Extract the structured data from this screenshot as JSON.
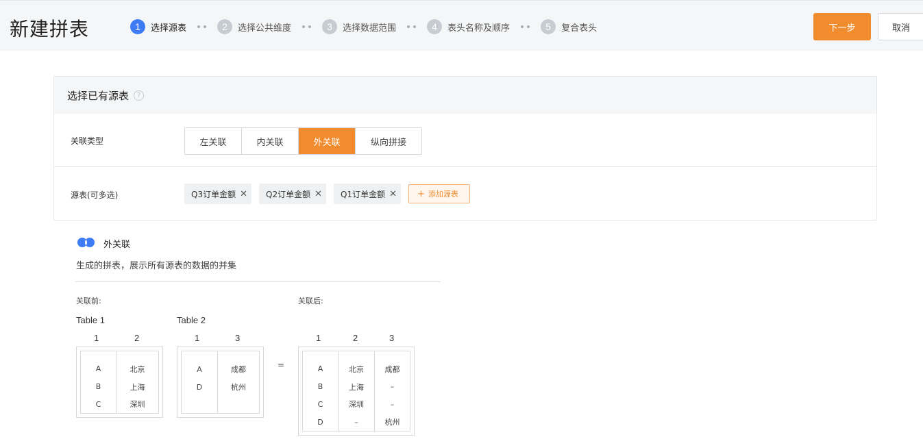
{
  "header": {
    "title": "新建拼表",
    "steps": [
      {
        "num": "1",
        "label": "选择源表"
      },
      {
        "num": "2",
        "label": "选择公共维度"
      },
      {
        "num": "3",
        "label": "选择数据范围"
      },
      {
        "num": "4",
        "label": "表头名称及顺序"
      },
      {
        "num": "5",
        "label": "复合表头"
      }
    ],
    "next_label": "下一步",
    "cancel_label": "取消"
  },
  "card": {
    "title": "选择已有源表",
    "help_glyph": "?",
    "join_type_label": "关联类型",
    "join_types": [
      "左关联",
      "内关联",
      "外关联",
      "纵向拼接"
    ],
    "source_label": "源表(可多选)",
    "sources": [
      "Q3订单金额",
      "Q2订单金额",
      "Q1订单金额"
    ],
    "add_source_label": "添加源表"
  },
  "explain": {
    "title": "外关联",
    "desc": "生成的拼表，展示所有源表的数据的并集",
    "before_label": "关联前:",
    "after_label": "关联后:",
    "equals": "=",
    "table1": {
      "name": "Table 1",
      "cols": [
        "1",
        "2"
      ],
      "rows": [
        [
          "A",
          "北京"
        ],
        [
          "B",
          "上海"
        ],
        [
          "C",
          "深圳"
        ]
      ]
    },
    "table2": {
      "name": "Table 2",
      "cols": [
        "1",
        "3"
      ],
      "rows": [
        [
          "A",
          "成都"
        ],
        [
          "D",
          "杭州"
        ]
      ]
    },
    "result": {
      "cols": [
        "1",
        "2",
        "3"
      ],
      "rows": [
        [
          "A",
          "北京",
          "成都"
        ],
        [
          "B",
          "上海",
          "–"
        ],
        [
          "C",
          "深圳",
          "–"
        ],
        [
          "D",
          "–",
          "杭州"
        ]
      ]
    }
  },
  "colors": {
    "accent": "#f08c2e",
    "step_active": "#3d7cf5",
    "join_icon": "#3d7cf5"
  }
}
